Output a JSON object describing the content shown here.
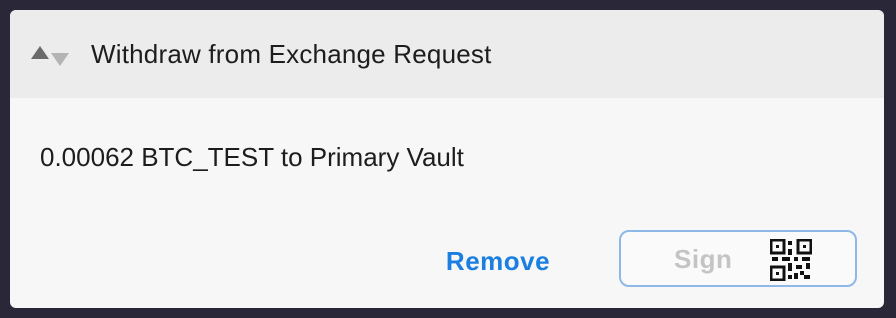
{
  "card": {
    "title": "Withdraw from Exchange Request",
    "sort_icon": "sort-arrows-icon",
    "message": "0.00062 BTC_TEST to Primary Vault"
  },
  "actions": {
    "remove_label": "Remove",
    "sign_label": "Sign",
    "sign_icon": "qr-code-icon"
  },
  "colors": {
    "accent": "#1a7fe0",
    "header_bg": "#ececec",
    "card_bg": "#f7f7f7",
    "sign_border": "#8eb8e8",
    "disabled_text": "#c4c4c4",
    "page_bg": "#2a2838"
  }
}
